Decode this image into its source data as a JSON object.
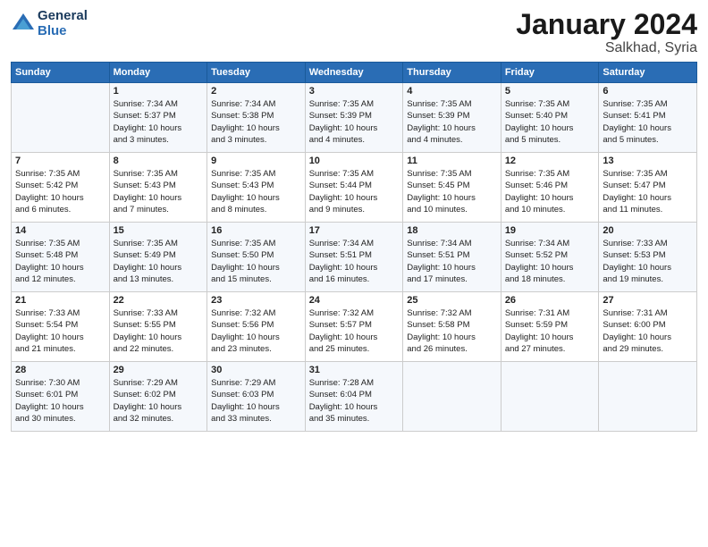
{
  "header": {
    "logo_general": "General",
    "logo_blue": "Blue",
    "month_year": "January 2024",
    "location": "Salkhad, Syria"
  },
  "days_of_week": [
    "Sunday",
    "Monday",
    "Tuesday",
    "Wednesday",
    "Thursday",
    "Friday",
    "Saturday"
  ],
  "weeks": [
    [
      {
        "day": "",
        "content": ""
      },
      {
        "day": "1",
        "content": "Sunrise: 7:34 AM\nSunset: 5:37 PM\nDaylight: 10 hours\nand 3 minutes."
      },
      {
        "day": "2",
        "content": "Sunrise: 7:34 AM\nSunset: 5:38 PM\nDaylight: 10 hours\nand 3 minutes."
      },
      {
        "day": "3",
        "content": "Sunrise: 7:35 AM\nSunset: 5:39 PM\nDaylight: 10 hours\nand 4 minutes."
      },
      {
        "day": "4",
        "content": "Sunrise: 7:35 AM\nSunset: 5:39 PM\nDaylight: 10 hours\nand 4 minutes."
      },
      {
        "day": "5",
        "content": "Sunrise: 7:35 AM\nSunset: 5:40 PM\nDaylight: 10 hours\nand 5 minutes."
      },
      {
        "day": "6",
        "content": "Sunrise: 7:35 AM\nSunset: 5:41 PM\nDaylight: 10 hours\nand 5 minutes."
      }
    ],
    [
      {
        "day": "7",
        "content": "Sunrise: 7:35 AM\nSunset: 5:42 PM\nDaylight: 10 hours\nand 6 minutes."
      },
      {
        "day": "8",
        "content": "Sunrise: 7:35 AM\nSunset: 5:43 PM\nDaylight: 10 hours\nand 7 minutes."
      },
      {
        "day": "9",
        "content": "Sunrise: 7:35 AM\nSunset: 5:43 PM\nDaylight: 10 hours\nand 8 minutes."
      },
      {
        "day": "10",
        "content": "Sunrise: 7:35 AM\nSunset: 5:44 PM\nDaylight: 10 hours\nand 9 minutes."
      },
      {
        "day": "11",
        "content": "Sunrise: 7:35 AM\nSunset: 5:45 PM\nDaylight: 10 hours\nand 10 minutes."
      },
      {
        "day": "12",
        "content": "Sunrise: 7:35 AM\nSunset: 5:46 PM\nDaylight: 10 hours\nand 10 minutes."
      },
      {
        "day": "13",
        "content": "Sunrise: 7:35 AM\nSunset: 5:47 PM\nDaylight: 10 hours\nand 11 minutes."
      }
    ],
    [
      {
        "day": "14",
        "content": "Sunrise: 7:35 AM\nSunset: 5:48 PM\nDaylight: 10 hours\nand 12 minutes."
      },
      {
        "day": "15",
        "content": "Sunrise: 7:35 AM\nSunset: 5:49 PM\nDaylight: 10 hours\nand 13 minutes."
      },
      {
        "day": "16",
        "content": "Sunrise: 7:35 AM\nSunset: 5:50 PM\nDaylight: 10 hours\nand 15 minutes."
      },
      {
        "day": "17",
        "content": "Sunrise: 7:34 AM\nSunset: 5:51 PM\nDaylight: 10 hours\nand 16 minutes."
      },
      {
        "day": "18",
        "content": "Sunrise: 7:34 AM\nSunset: 5:51 PM\nDaylight: 10 hours\nand 17 minutes."
      },
      {
        "day": "19",
        "content": "Sunrise: 7:34 AM\nSunset: 5:52 PM\nDaylight: 10 hours\nand 18 minutes."
      },
      {
        "day": "20",
        "content": "Sunrise: 7:33 AM\nSunset: 5:53 PM\nDaylight: 10 hours\nand 19 minutes."
      }
    ],
    [
      {
        "day": "21",
        "content": "Sunrise: 7:33 AM\nSunset: 5:54 PM\nDaylight: 10 hours\nand 21 minutes."
      },
      {
        "day": "22",
        "content": "Sunrise: 7:33 AM\nSunset: 5:55 PM\nDaylight: 10 hours\nand 22 minutes."
      },
      {
        "day": "23",
        "content": "Sunrise: 7:32 AM\nSunset: 5:56 PM\nDaylight: 10 hours\nand 23 minutes."
      },
      {
        "day": "24",
        "content": "Sunrise: 7:32 AM\nSunset: 5:57 PM\nDaylight: 10 hours\nand 25 minutes."
      },
      {
        "day": "25",
        "content": "Sunrise: 7:32 AM\nSunset: 5:58 PM\nDaylight: 10 hours\nand 26 minutes."
      },
      {
        "day": "26",
        "content": "Sunrise: 7:31 AM\nSunset: 5:59 PM\nDaylight: 10 hours\nand 27 minutes."
      },
      {
        "day": "27",
        "content": "Sunrise: 7:31 AM\nSunset: 6:00 PM\nDaylight: 10 hours\nand 29 minutes."
      }
    ],
    [
      {
        "day": "28",
        "content": "Sunrise: 7:30 AM\nSunset: 6:01 PM\nDaylight: 10 hours\nand 30 minutes."
      },
      {
        "day": "29",
        "content": "Sunrise: 7:29 AM\nSunset: 6:02 PM\nDaylight: 10 hours\nand 32 minutes."
      },
      {
        "day": "30",
        "content": "Sunrise: 7:29 AM\nSunset: 6:03 PM\nDaylight: 10 hours\nand 33 minutes."
      },
      {
        "day": "31",
        "content": "Sunrise: 7:28 AM\nSunset: 6:04 PM\nDaylight: 10 hours\nand 35 minutes."
      },
      {
        "day": "",
        "content": ""
      },
      {
        "day": "",
        "content": ""
      },
      {
        "day": "",
        "content": ""
      }
    ]
  ]
}
